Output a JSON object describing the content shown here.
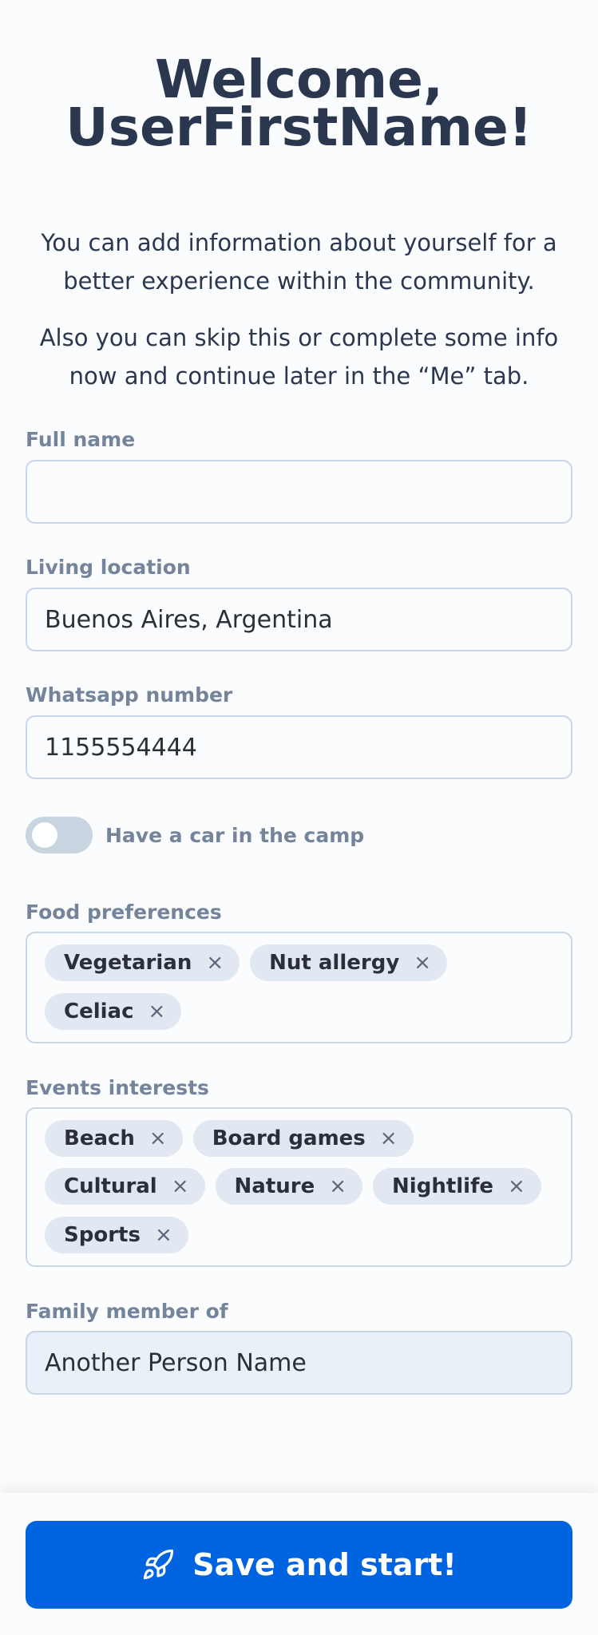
{
  "header": {
    "title_line1": "Welcome,",
    "title_line2": "UserFirstName!",
    "intro_p1": "You can add information about yourself for a better experience within the community.",
    "intro_p2": "Also you can skip this or complete some info now and continue later in the “Me” tab."
  },
  "form": {
    "full_name": {
      "label": "Full name",
      "value": ""
    },
    "living_location": {
      "label": "Living location",
      "value": "Buenos Aires, Argentina"
    },
    "whatsapp": {
      "label": "Whatsapp number",
      "value": "1155554444"
    },
    "car_toggle": {
      "label": "Have a car in the camp",
      "on": false
    },
    "food_preferences": {
      "label": "Food preferences",
      "chips": [
        "Vegetarian",
        "Nut allergy",
        "Celiac"
      ]
    },
    "events_interests": {
      "label": "Events interests",
      "chips": [
        "Beach",
        "Board games",
        "Cultural",
        "Nature",
        "Nightlife",
        "Sports"
      ]
    },
    "family_member": {
      "label": "Family member of",
      "value": "Another Person Name"
    }
  },
  "footer": {
    "save_label": "Save and start!",
    "save_icon": "rocket-icon",
    "accent_color": "#0063e0"
  },
  "icons": {
    "chip_remove": "×"
  }
}
